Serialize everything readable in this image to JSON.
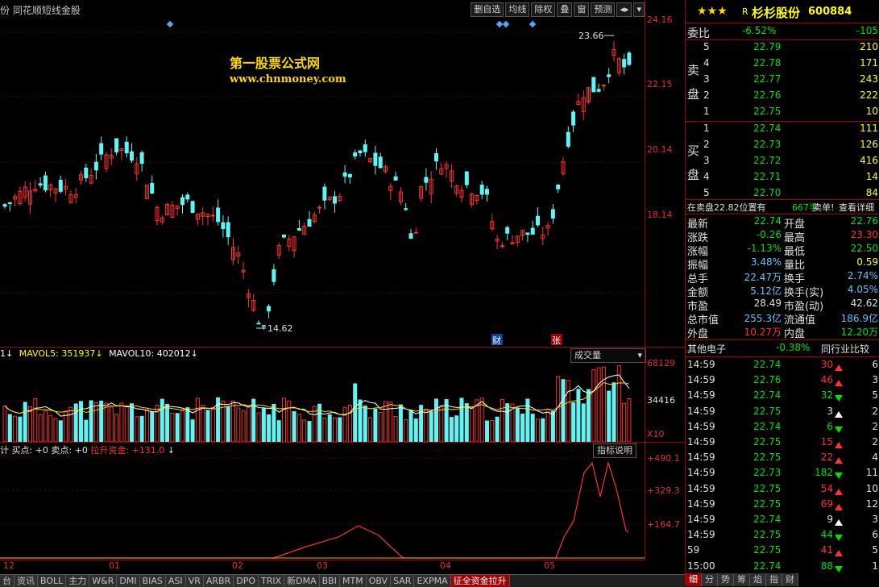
{
  "header": {
    "title": "份  同花顺短线金股",
    "buttons": [
      "删自选",
      "均线",
      "除权",
      "叠",
      "窗",
      "预测",
      "◂▸",
      "▾"
    ]
  },
  "watermark": {
    "line1": "第一股票公式网",
    "line2": "www.chnmoney.com"
  },
  "price_axis": [
    "24.16",
    "22.15",
    "20.14",
    "18.14"
  ],
  "high_label": "23.66",
  "low_label": "14.62",
  "markers": {
    "cai": "财",
    "zhang": "张"
  },
  "volume": {
    "header": [
      "1↓",
      "MAVOL5: 351937↓",
      "MAVOL10: 402012↓"
    ],
    "dropdown": "成交量",
    "axis": [
      "68129",
      "34416",
      "X10"
    ]
  },
  "indicator": {
    "header_prefix": "计 买点: +0 卖点: +0",
    "header_red": "拉升资金: +131.0",
    "header_suffix": "↓",
    "button": "指标说明",
    "axis": [
      "+490.1",
      "+329.3",
      "+164.7"
    ]
  },
  "date_axis": [
    "12",
    "01",
    "02",
    "03",
    "04",
    "05"
  ],
  "bottom_tabs": [
    "台",
    "资讯",
    "BOLL",
    "主力",
    "W&R",
    "DMI",
    "BIAS",
    "ASI",
    "VR",
    "ARBR",
    "DPO",
    "TRIX",
    "新DMA",
    "BBI",
    "MTM",
    "OBV",
    "SAR",
    "EXPMA",
    "征全资金拉升"
  ],
  "active_bottom_tab": "征全资金拉升",
  "stock": {
    "stars": "★★★",
    "r": "R",
    "name": "杉杉股份",
    "code": "600884"
  },
  "weibi": {
    "label": "委比",
    "pct": "-6.52%",
    "diff": "-105"
  },
  "sell_side_label": [
    "卖",
    "盘"
  ],
  "buy_side_label": [
    "买",
    "盘"
  ],
  "sells": [
    {
      "lvl": "5",
      "price": "22.79",
      "vol": "210"
    },
    {
      "lvl": "4",
      "price": "22.78",
      "vol": "171"
    },
    {
      "lvl": "3",
      "price": "22.77",
      "vol": "243"
    },
    {
      "lvl": "2",
      "price": "22.76",
      "vol": "222"
    },
    {
      "lvl": "1",
      "price": "22.75",
      "vol": "10"
    }
  ],
  "buys": [
    {
      "lvl": "1",
      "price": "22.74",
      "vol": "111"
    },
    {
      "lvl": "2",
      "price": "22.73",
      "vol": "126"
    },
    {
      "lvl": "3",
      "price": "22.72",
      "vol": "416"
    },
    {
      "lvl": "4",
      "price": "22.71",
      "vol": "14"
    },
    {
      "lvl": "5",
      "price": "22.70",
      "vol": "84"
    }
  ],
  "status_line": {
    "a": "在卖盘22.82位置有",
    "b": "667手",
    "c": "卖单!",
    "d": "查看详细"
  },
  "quote": [
    {
      "l1": "最新",
      "v1": "22.74",
      "c1": "green",
      "l2": "开盘",
      "v2": "22.76",
      "c2": "green"
    },
    {
      "l1": "涨跌",
      "v1": "-0.26",
      "c1": "green",
      "l2": "最高",
      "v2": "23.30",
      "c2": "red"
    },
    {
      "l1": "涨幅",
      "v1": "-1.13%",
      "c1": "green",
      "l2": "最低",
      "v2": "22.50",
      "c2": "green"
    },
    {
      "l1": "振幅",
      "v1": "3.48%",
      "c1": "cyan",
      "l2": "量比",
      "v2": "0.59",
      "c2": "yellow"
    },
    {
      "l1": "总手",
      "v1": "22.47万",
      "c1": "cyan",
      "l2": "换手",
      "v2": "2.74%",
      "c2": "cyan"
    },
    {
      "l1": "金额",
      "v1": "5.12亿",
      "c1": "cyan",
      "l2": "换手(实)",
      "v2": "4.05%",
      "c2": "cyan"
    },
    {
      "l1": "市盈",
      "v1": "28.49",
      "c1": "white",
      "l2": "市盈(动)",
      "v2": "42.62",
      "c2": "white"
    },
    {
      "l1": "总市值",
      "v1": "255.3亿",
      "c1": "cyan",
      "l2": "流通值",
      "v2": "186.9亿",
      "c2": "cyan"
    },
    {
      "l1": "外盘",
      "v1": "10.27万",
      "c1": "red",
      "l2": "内盘",
      "v2": "12.20万",
      "c2": "green"
    }
  ],
  "sector": {
    "name": "其他电子",
    "pct": "-0.38%",
    "btn": "同行业比较"
  },
  "ticks": [
    {
      "t": "14:59",
      "p": "22.74",
      "v": "30",
      "dir": "up",
      "n": "6"
    },
    {
      "t": "14:59",
      "p": "22.76",
      "v": "46",
      "dir": "up",
      "n": "3"
    },
    {
      "t": "14:59",
      "p": "22.74",
      "v": "32",
      "dir": "dn",
      "n": "5"
    },
    {
      "t": "14:59",
      "p": "22.75",
      "v": "3",
      "dir": "upw",
      "n": "2"
    },
    {
      "t": "14:59",
      "p": "22.74",
      "v": "6",
      "dir": "dn",
      "n": "2"
    },
    {
      "t": "14:59",
      "p": "22.75",
      "v": "15",
      "dir": "up",
      "n": "2"
    },
    {
      "t": "14:59",
      "p": "22.75",
      "v": "22",
      "dir": "up",
      "n": "4"
    },
    {
      "t": "14:59",
      "p": "22.73",
      "v": "182",
      "dir": "dn",
      "n": "11"
    },
    {
      "t": "14:59",
      "p": "22.75",
      "v": "54",
      "dir": "up",
      "n": "10"
    },
    {
      "t": "14:59",
      "p": "22.75",
      "v": "69",
      "dir": "up",
      "n": "12"
    },
    {
      "t": "14:59",
      "p": "22.74",
      "v": "9",
      "dir": "upw",
      "n": "3"
    },
    {
      "t": "14:59",
      "p": "22.75",
      "v": "44",
      "dir": "dn",
      "n": "6"
    },
    {
      "t": "59",
      "p": "22.75",
      "v": "41",
      "dir": "up",
      "n": "5"
    },
    {
      "t": "15:00",
      "p": "22.74",
      "v": "88",
      "dir": "dn",
      "n": "1"
    }
  ],
  "right_tabs": [
    "细",
    "分",
    "势",
    "筹",
    "焰",
    "指",
    "财"
  ],
  "active_right_tab": "细",
  "colors": {
    "up": "#ff3030",
    "down": "#5ff5f5",
    "grid": "#a00000"
  }
}
